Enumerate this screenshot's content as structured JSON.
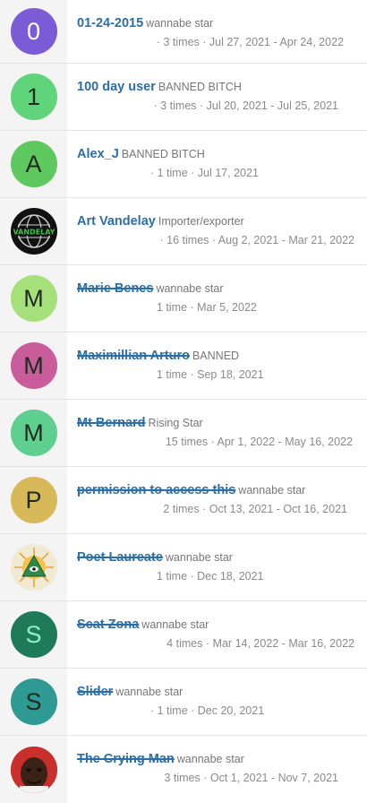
{
  "rows": [
    {
      "letter": "0",
      "color": "#7b5cd6",
      "name": "01-24-2015",
      "title": "wannabe star",
      "stats": "· 3 times · Jul 27, 2021 - Apr 24, 2022",
      "struck": false
    },
    {
      "letter": "1",
      "color": "#5fd47a",
      "name": "100 day user",
      "title": "BANNED BITCH",
      "stats": "· 3 times · Jul 20, 2021 - Jul 25, 2021",
      "struck": false
    },
    {
      "letter": "A",
      "color": "#5ec95e",
      "name": "Alex_J",
      "title": "BANNED BITCH",
      "stats": "· 1 time · Jul 17, 2021",
      "struck": false
    },
    {
      "letter": "",
      "color": "#111111",
      "name": "Art Vandelay",
      "title": "Importer/exporter",
      "stats": "· 16 times · Aug 2, 2021 - Mar 21, 2022",
      "struck": false,
      "logo_text": "VANDELAY"
    },
    {
      "letter": "M",
      "color": "#a6e07a",
      "name": "Marie Benes",
      "title": "wannabe star",
      "stats": "1 time · Mar 5, 2022",
      "struck": true
    },
    {
      "letter": "M",
      "color": "#c95c9a",
      "name": "Maximillian Arturo",
      "title": "BANNED",
      "stats": "1 time · Sep 18, 2021",
      "struck": true
    },
    {
      "letter": "M",
      "color": "#5fcf90",
      "name": "Mt Bernard",
      "title": "Rising Star",
      "stats": "15 times · Apr 1, 2022 - May 16, 2022",
      "struck": true
    },
    {
      "letter": "P",
      "color": "#d8b95a",
      "name": "permission to access this",
      "title": "wannabe star",
      "stats": "2 times · Oct 13, 2021 - Oct 16, 2021",
      "struck": true
    },
    {
      "letter": "",
      "color": "#f1ead2",
      "name": "Poet Laureate",
      "title": "wannabe star",
      "stats": "1 time · Dec 18, 2021",
      "struck": true
    },
    {
      "letter": "S",
      "color": "#1f7a5a",
      "name": "Scat Zona",
      "title": "wannabe star",
      "stats": "4 times · Mar 14, 2022 - Mar 16, 2022",
      "struck": true
    },
    {
      "letter": "S",
      "color": "#2f9a93",
      "name": "Slider",
      "title": "wannabe star",
      "stats": "· 1 time · Dec 20, 2021",
      "struck": true
    },
    {
      "letter": "",
      "color": "#c9302c",
      "name": "The Crying Man",
      "title": "wannabe star",
      "stats": "3 times · Oct 1, 2021 - Nov 7, 2021",
      "struck": true
    }
  ]
}
